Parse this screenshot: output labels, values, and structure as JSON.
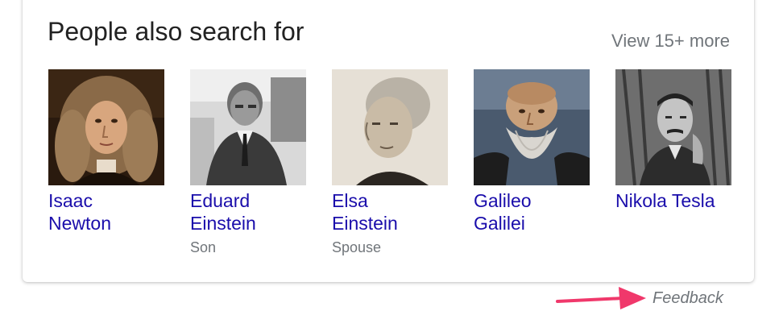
{
  "panel": {
    "title": "People also search for",
    "view_more": "View 15+ more"
  },
  "people": [
    {
      "name_line1": "Isaac",
      "name_line2": "Newton",
      "subtitle": "",
      "portrait_icon": "isaac-newton-portrait"
    },
    {
      "name_line1": "Eduard",
      "name_line2": "Einstein",
      "subtitle": "Son",
      "portrait_icon": "eduard-einstein-portrait"
    },
    {
      "name_line1": "Elsa",
      "name_line2": "Einstein",
      "subtitle": "Spouse",
      "portrait_icon": "elsa-einstein-portrait"
    },
    {
      "name_line1": "Galileo",
      "name_line2": "Galilei",
      "subtitle": "",
      "portrait_icon": "galileo-galilei-portrait"
    },
    {
      "name_line1": "Nikola Tesla",
      "name_line2": "",
      "subtitle": "",
      "portrait_icon": "nikola-tesla-portrait"
    }
  ],
  "footer": {
    "feedback": "Feedback"
  },
  "colors": {
    "link": "#1a0dab",
    "muted": "#70757a",
    "title": "#222222",
    "annotation_arrow": "#f0386b"
  }
}
